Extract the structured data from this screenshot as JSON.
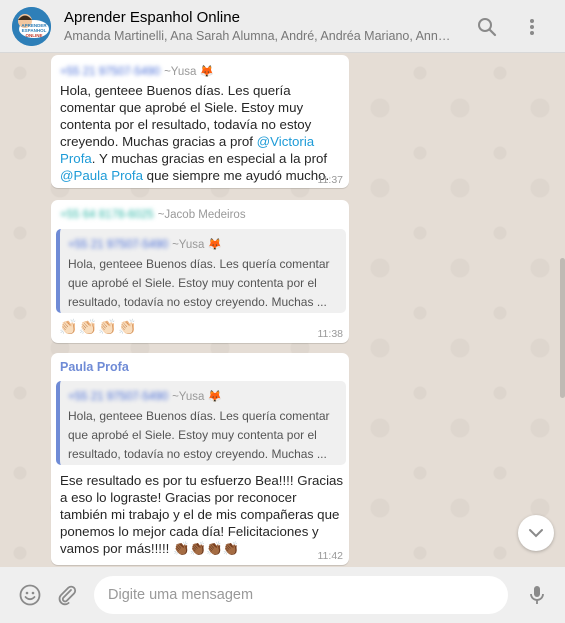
{
  "header": {
    "title": "Aprender Espanhol Online",
    "members": "Amanda Martinelli, Ana Sarah Alumna, André, Andréa Mariano, Anne Me...",
    "avatar_text": "APRENDER ESPANHOL ONLINE"
  },
  "messages": [
    {
      "phone": "+55 21 97507-5490",
      "pushname": "~Yusa 🦊",
      "text_parts": [
        "Hola, genteee Buenos días. Les quería comentar que aprobé el Siele. Estoy muy contenta por el resultado, todavía no estoy creyendo. Muchas gracias a prof ",
        "@Victoria Profa",
        ". Y muchas gracias en especial a la prof ",
        "@Paula Profa",
        " que siempre me ayudó mucho."
      ],
      "time": "11:37"
    },
    {
      "phone": "+55 64 8178-6025",
      "pushname": "~Jacob Medeiros",
      "quote": {
        "phone": "+55 21 97507-5490",
        "pushname": "~Yusa 🦊",
        "text": "Hola, genteee Buenos días. Les quería comentar que aprobé el Siele. Estoy muy contenta por el resultado, todavía no estoy creyendo. Muchas ..."
      },
      "text": "👏🏻👏🏻👏🏻👏🏻",
      "time": "11:38"
    },
    {
      "author": "Paula Profa",
      "quote": {
        "phone": "+55 21 97507-5490",
        "pushname": "~Yusa 🦊",
        "text": "Hola, genteee Buenos días. Les quería comentar que aprobé el Siele. Estoy muy contenta por el resultado, todavía no estoy creyendo. Muchas ..."
      },
      "text": "Ese resultado es por tu esfuerzo Bea!!!! Gracias a eso lo lograste! Gracias por reconocer también mi trabajo y el de mis compañeras que ponemos lo mejor cada día!  Felicitaciones y vamos por más!!!!! 👏🏾👏🏾👏🏾👏🏾",
      "time": "11:42"
    }
  ],
  "footer": {
    "placeholder": "Digite uma mensagem"
  },
  "icons": {
    "search": "search-icon",
    "menu": "more-vertical-icon",
    "emoji": "emoji-icon",
    "attach": "paperclip-icon",
    "mic": "microphone-icon",
    "scroll": "chevron-down-icon"
  },
  "colors": {
    "header_bg": "#ededed",
    "chat_bg": "#e5ddd5",
    "mention": "#1e9bd7",
    "author": "#6f8bd6",
    "quote_bar": "#6f8bd6"
  }
}
